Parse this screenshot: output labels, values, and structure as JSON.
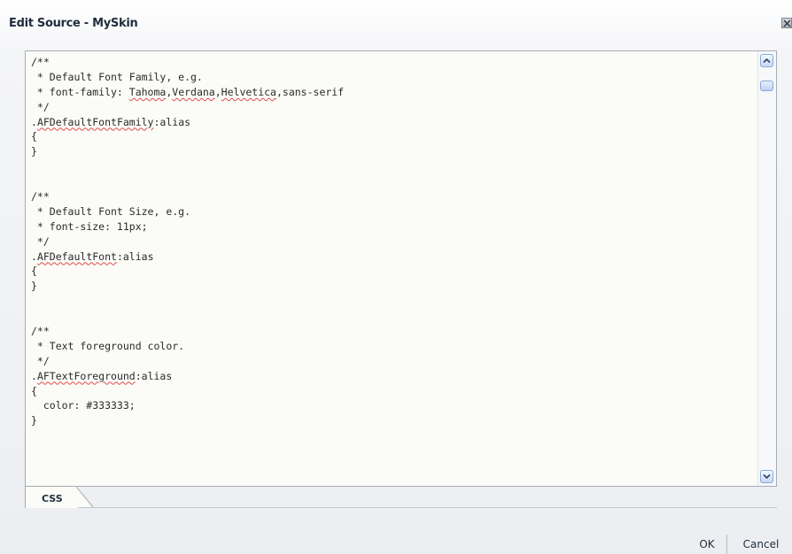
{
  "dialog": {
    "title": "Edit Source - MySkin",
    "close_icon": "close-x-icon"
  },
  "editor": {
    "lines": [
      "/**",
      " * Default Font Family, e.g.",
      " * font-family: Tahoma,Verdana,Helvetica,sans-serif",
      " */",
      ".AFDefaultFontFamily:alias",
      "{",
      "}",
      "",
      "",
      "/**",
      " * Default Font Size, e.g.",
      " * font-size: 11px;",
      " */",
      ".AFDefaultFont:alias",
      "{",
      "}",
      "",
      "",
      "/**",
      " * Text foreground color.",
      " */",
      ".AFTextForeground:alias",
      "{",
      "  color: #333333;",
      "}"
    ],
    "spellcheck_words": [
      "Tahoma",
      "Verdana",
      "Helvetica",
      "AFDefaultFontFamily",
      "AFDefaultFont",
      "AFTextForeground"
    ],
    "scroll_position": 0.0
  },
  "tabs": [
    {
      "label": "CSS",
      "selected": true
    }
  ],
  "buttons": {
    "ok_label": "OK",
    "cancel_label": "Cancel"
  },
  "colors": {
    "editor_background": "#fbfbf7",
    "spellcheck_underline": "#e24b4b",
    "scrollbar_accent": "#8aa8d6"
  }
}
